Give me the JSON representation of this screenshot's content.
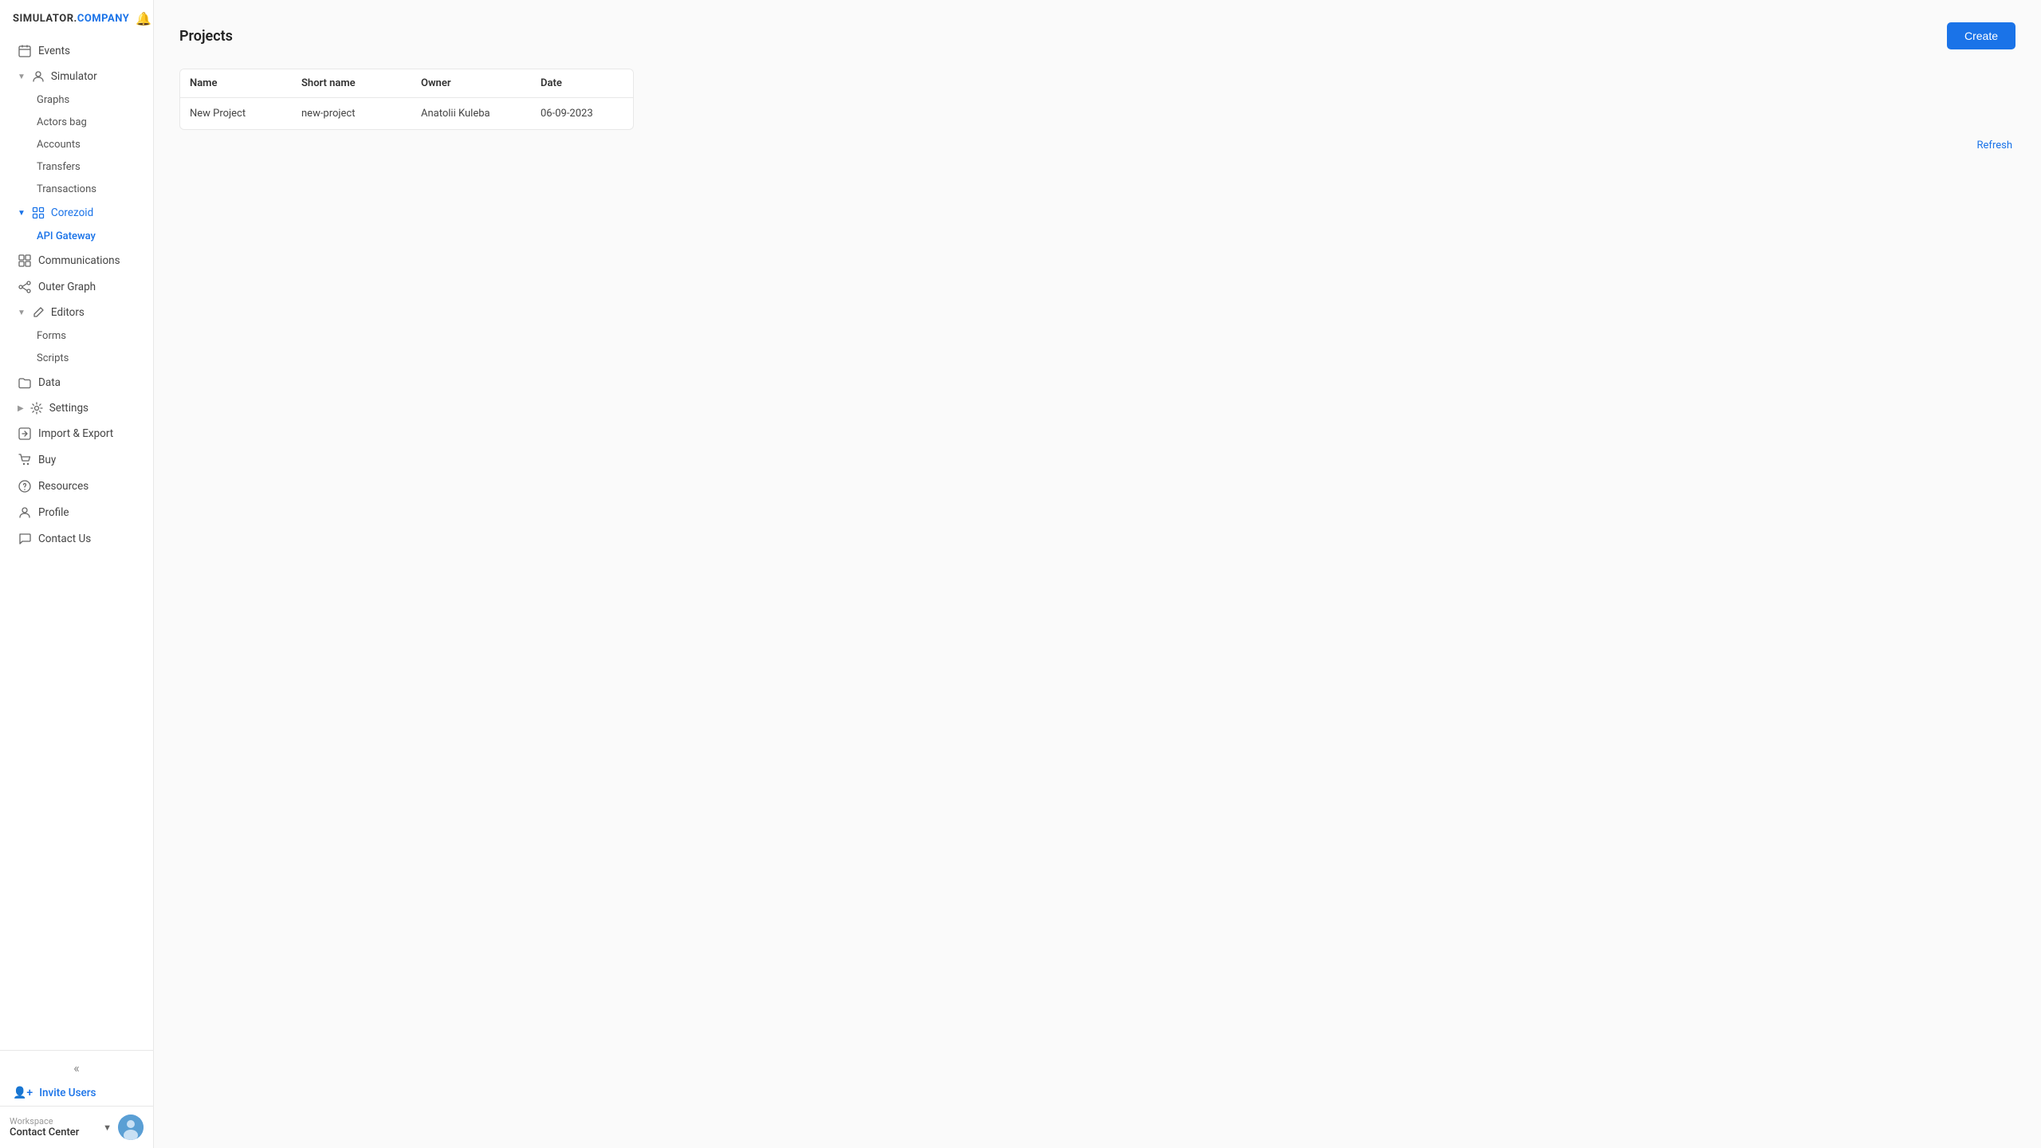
{
  "logo": {
    "text_simulator": "SIMULATOR.",
    "text_company": "COMPANY"
  },
  "sidebar": {
    "nav_items": [
      {
        "id": "events",
        "label": "Events",
        "icon": "calendar"
      },
      {
        "id": "simulator",
        "label": "Simulator",
        "icon": "user-group",
        "expanded": true,
        "children": [
          {
            "id": "graphs",
            "label": "Graphs"
          },
          {
            "id": "actors-bag",
            "label": "Actors bag"
          },
          {
            "id": "accounts",
            "label": "Accounts"
          },
          {
            "id": "transfers",
            "label": "Transfers"
          },
          {
            "id": "transactions",
            "label": "Transactions"
          }
        ]
      },
      {
        "id": "corezoid",
        "label": "Corezoid",
        "icon": "grid",
        "expanded": true,
        "active": true,
        "children": [
          {
            "id": "api-gateway",
            "label": "API Gateway",
            "active": true
          }
        ]
      },
      {
        "id": "communications",
        "label": "Communications",
        "icon": "apps"
      },
      {
        "id": "outer-graph",
        "label": "Outer Graph",
        "icon": "share"
      },
      {
        "id": "editors",
        "label": "Editors",
        "icon": "edit",
        "expanded": true,
        "children": [
          {
            "id": "forms",
            "label": "Forms"
          },
          {
            "id": "scripts",
            "label": "Scripts"
          }
        ]
      },
      {
        "id": "data",
        "label": "Data",
        "icon": "folder"
      },
      {
        "id": "settings",
        "label": "Settings",
        "icon": "gear"
      },
      {
        "id": "import-export",
        "label": "Import & Export",
        "icon": "transfer"
      },
      {
        "id": "buy",
        "label": "Buy",
        "icon": "cart"
      },
      {
        "id": "resources",
        "label": "Resources",
        "icon": "question"
      },
      {
        "id": "profile",
        "label": "Profile",
        "icon": "person"
      },
      {
        "id": "contact-us",
        "label": "Contact Us",
        "icon": "chat"
      }
    ],
    "collapse_label": "«",
    "invite_users_label": "Invite Users",
    "workspace": {
      "label": "Workspace",
      "name": "Contact Center",
      "arrow": "▼"
    }
  },
  "main": {
    "title": "Projects",
    "create_button": "Create",
    "refresh_label": "Refresh",
    "table": {
      "columns": [
        "Name",
        "Short name",
        "Owner",
        "Date"
      ],
      "rows": [
        {
          "name": "New Project",
          "short_name": "new-project",
          "owner": "Anatolii Kuleba",
          "date": "06-09-2023"
        }
      ]
    }
  }
}
